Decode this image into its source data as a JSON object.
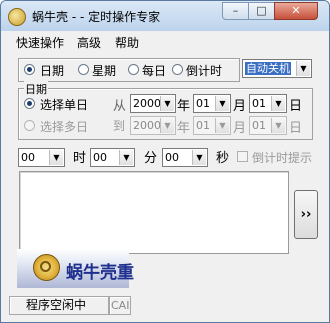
{
  "window": {
    "title": "蜗牛壳 - - 定时操作专家"
  },
  "menu": [
    "快速操作",
    "高级",
    "帮助"
  ],
  "mode": {
    "options": [
      "日期",
      "星期",
      "每日",
      "倒计时"
    ],
    "selected_index": 0,
    "action_value": "自动关机"
  },
  "date_group": {
    "legend": "日期",
    "single_label": "选择单日",
    "multi_label": "选择多日",
    "from_label": "从",
    "to_label": "到",
    "year_unit": "年",
    "month_unit": "月",
    "day_unit": "日",
    "from": {
      "year": "2000",
      "month": "01",
      "day": "01"
    },
    "to": {
      "year": "2000",
      "month": "01",
      "day": "01"
    }
  },
  "time": {
    "hour": "00",
    "hour_unit": "时",
    "minute": "00",
    "minute_unit": "分",
    "second": "00",
    "second_unit": "秒",
    "countdown_hint": "倒计时提示"
  },
  "go_button": "››",
  "logo_text": "蜗牛壳重",
  "status": {
    "state": "程序空闲中",
    "caps": "CAI"
  }
}
